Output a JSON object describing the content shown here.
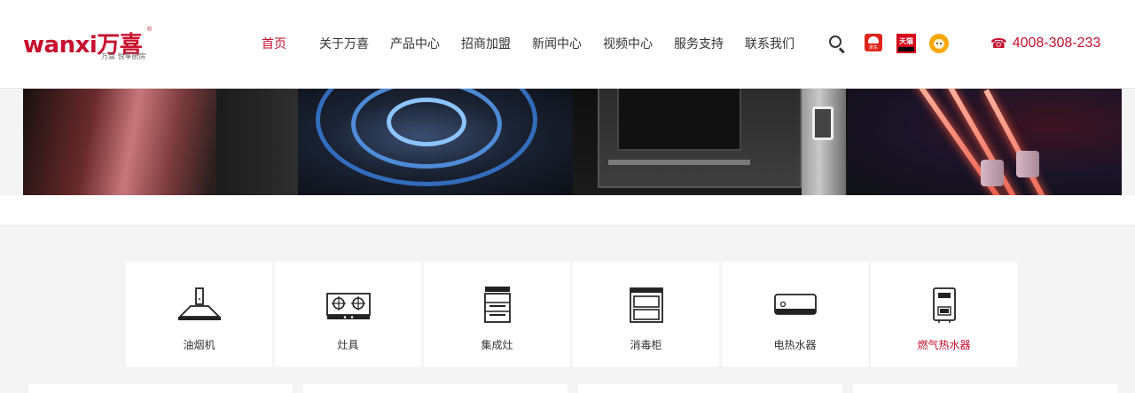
{
  "brand": {
    "logo_text": "wanxi万喜",
    "logo_sub": "万喜  悦享厨房",
    "logo_reg": "®",
    "color": "#c8102e"
  },
  "nav": {
    "items": [
      {
        "label": "首页",
        "active": true
      },
      {
        "label": "关于万喜"
      },
      {
        "label": "产品中心"
      },
      {
        "label": "招商加盟"
      },
      {
        "label": "新闻中心"
      },
      {
        "label": "视频中心"
      },
      {
        "label": "服务支持"
      },
      {
        "label": "联系我们"
      }
    ]
  },
  "tools": {
    "search_icon": "search-icon",
    "jd_label": "京东",
    "tmall_label": "天猫",
    "suning_icon": "suning-lion-icon"
  },
  "contact": {
    "phone_icon": "☎",
    "phone": "4008-308-233"
  },
  "categories": [
    {
      "label": "油烟机",
      "icon": "range-hood-icon"
    },
    {
      "label": "灶具",
      "icon": "gas-stove-icon"
    },
    {
      "label": "集成灶",
      "icon": "integrated-stove-icon"
    },
    {
      "label": "消毒柜",
      "icon": "disinfection-cabinet-icon"
    },
    {
      "label": "电热水器",
      "icon": "electric-water-heater-icon"
    },
    {
      "label": "燃气热水器",
      "icon": "gas-water-heater-icon",
      "active": true
    }
  ]
}
